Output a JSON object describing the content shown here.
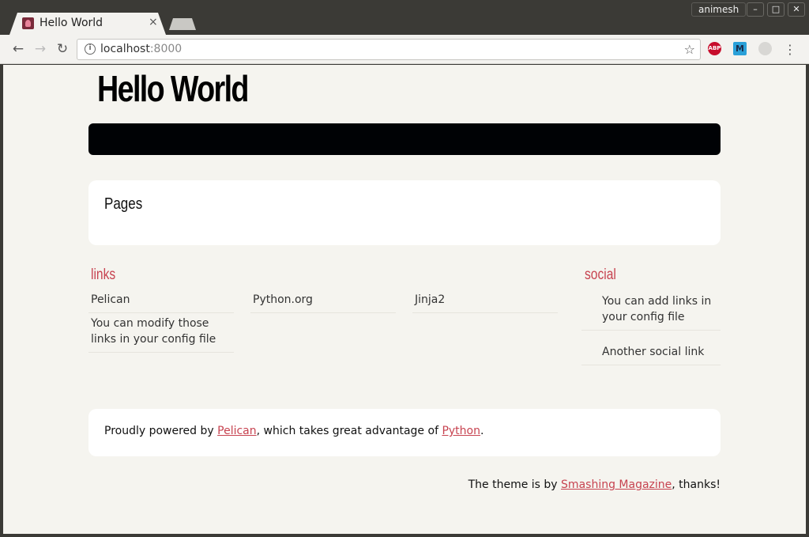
{
  "browser": {
    "tab_title": "Hello World",
    "tab_close": "×",
    "user": "animesh",
    "window_buttons": [
      "–",
      "□",
      "✕"
    ],
    "url_host": "localhost",
    "url_port": ":8000",
    "extensions": {
      "abp": "ABP",
      "m": "M"
    }
  },
  "site": {
    "title": "Hello World",
    "pages_heading": "Pages",
    "links_heading": "links",
    "links": [
      {
        "label": "Pelican"
      },
      {
        "label": "Python.org"
      },
      {
        "label": "Jinja2"
      },
      {
        "label": "You can modify those links in your config file"
      }
    ],
    "social_heading": "social",
    "social": [
      {
        "label": "You can add links in your config file"
      },
      {
        "label": "Another social link"
      }
    ],
    "footer": {
      "prefix": "Proudly powered by ",
      "link1": "Pelican",
      "middle": ", which takes great advantage of ",
      "link2": "Python",
      "suffix": "."
    },
    "theme_credit": {
      "prefix": "The theme is by ",
      "link": "Smashing Magazine",
      "suffix": ", thanks!"
    }
  },
  "colors": {
    "accent": "#c74350",
    "menubar": "#000205",
    "page_bg": "#f5f4ef"
  }
}
